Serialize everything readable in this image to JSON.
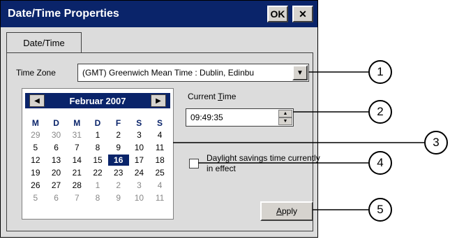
{
  "window": {
    "title": "Date/Time Properties",
    "ok_label": "OK",
    "close_label": "✕"
  },
  "tabs": [
    {
      "label": "Date/Time"
    }
  ],
  "timezone": {
    "label": "Time Zone",
    "value": "(GMT) Greenwich Mean Time : Dublin, Edinbu",
    "dropdown_icon": "▼"
  },
  "calendar": {
    "month_label": "Februar 2007",
    "prev_icon": "◀",
    "next_icon": "▶",
    "weekdays": [
      "M",
      "D",
      "M",
      "D",
      "F",
      "S",
      "S"
    ],
    "weeks": [
      [
        "29",
        "30",
        "31",
        "1",
        "2",
        "3",
        "4"
      ],
      [
        "5",
        "6",
        "7",
        "8",
        "9",
        "10",
        "11"
      ],
      [
        "12",
        "13",
        "14",
        "15",
        "16",
        "17",
        "18"
      ],
      [
        "19",
        "20",
        "21",
        "22",
        "23",
        "24",
        "25"
      ],
      [
        "26",
        "27",
        "28",
        "1",
        "2",
        "3",
        "4"
      ],
      [
        "5",
        "6",
        "7",
        "8",
        "9",
        "10",
        "11"
      ]
    ],
    "selected": "16"
  },
  "current_time": {
    "label": "Current Time",
    "value": "09:49:35"
  },
  "daylight": {
    "label": "Daylight savings time currently in effect",
    "checked": false
  },
  "apply_label": "Apply",
  "callouts": [
    "1",
    "2",
    "3",
    "4",
    "5"
  ],
  "colors": {
    "titlebar": "#0a246a",
    "window_bg": "#dcdcdc"
  }
}
